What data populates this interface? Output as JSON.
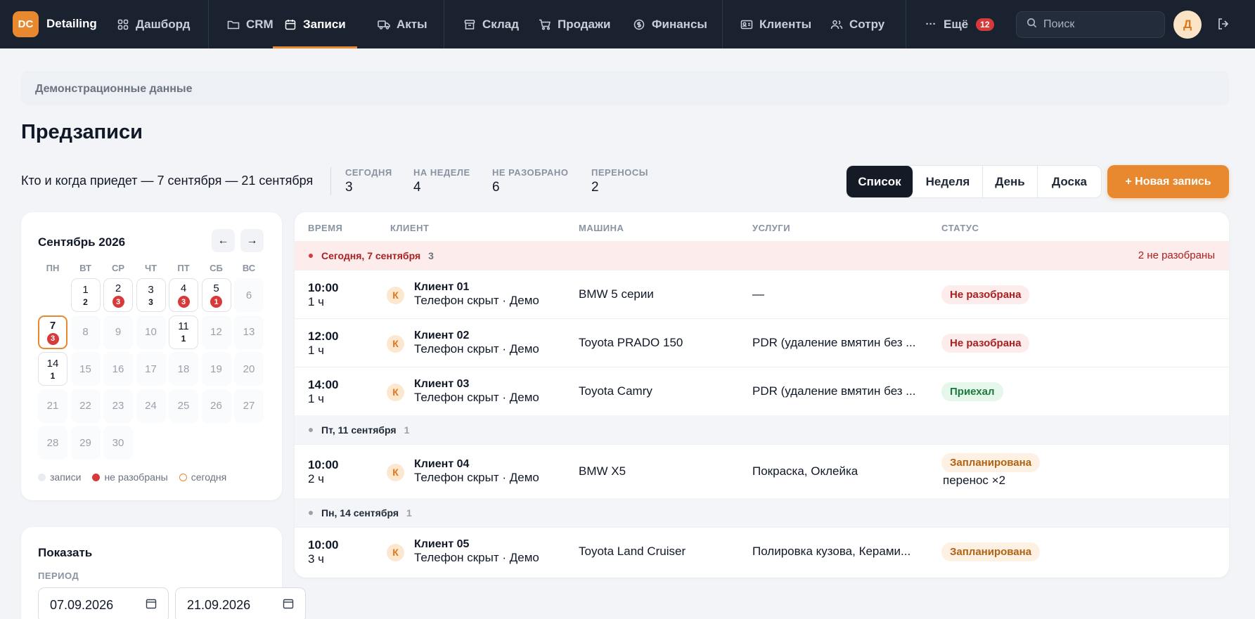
{
  "app": {
    "logo_text": "DC",
    "brand": "Detailing"
  },
  "nav": {
    "items": [
      {
        "label": "Дашборд",
        "icon": "dashboard-icon"
      },
      {
        "label": "CRM",
        "icon": "folder-icon"
      },
      {
        "label": "Записи",
        "icon": "calendar-icon",
        "active": true
      },
      {
        "label": "Акты",
        "icon": "truck-icon"
      },
      {
        "label": "Склад",
        "icon": "archive-icon"
      },
      {
        "label": "Продажи",
        "icon": "cart-icon"
      },
      {
        "label": "Финансы",
        "icon": "dollar-icon"
      },
      {
        "label": "Клиенты",
        "icon": "id-card-icon"
      },
      {
        "label": "Сотру",
        "icon": "users-icon"
      },
      {
        "label": "Ещё",
        "icon": "more-icon",
        "badge": "12"
      }
    ],
    "search_placeholder": "Поиск",
    "avatar": "Д"
  },
  "banner": "Демонстрационные данные",
  "page": {
    "title": "Предзаписи",
    "subtitle": "Кто и когда приедет — 7 сентября — 21 сентября",
    "stats": [
      {
        "label": "СЕГОДНЯ",
        "value": "3"
      },
      {
        "label": "НА НЕДЕЛЕ",
        "value": "4"
      },
      {
        "label": "НЕ РАЗОБРАНО",
        "value": "6"
      },
      {
        "label": "ПЕРЕНОСЫ",
        "value": "2"
      }
    ],
    "views": [
      "Список",
      "Неделя",
      "День",
      "Доска"
    ],
    "active_view": "Список",
    "new_button": "+ Новая запись"
  },
  "calendar": {
    "title": "Сентябрь 2026",
    "weekdays": [
      "ПН",
      "ВТ",
      "СР",
      "ЧТ",
      "ПТ",
      "СБ",
      "ВС"
    ],
    "days": [
      {
        "d": "1",
        "c": "2"
      },
      {
        "d": "2",
        "c": "3",
        "red": true
      },
      {
        "d": "3",
        "c": "3"
      },
      {
        "d": "4",
        "c": "3",
        "red": true
      },
      {
        "d": "5",
        "c": "1",
        "red": true
      },
      {
        "d": "6"
      },
      {
        "d": "7",
        "c": "3",
        "red": true,
        "today": true
      },
      {
        "d": "8"
      },
      {
        "d": "9"
      },
      {
        "d": "10"
      },
      {
        "d": "11",
        "c": "1"
      },
      {
        "d": "12"
      },
      {
        "d": "13"
      },
      {
        "d": "14",
        "c": "1"
      },
      {
        "d": "15"
      },
      {
        "d": "16"
      },
      {
        "d": "17"
      },
      {
        "d": "18"
      },
      {
        "d": "19"
      },
      {
        "d": "20"
      },
      {
        "d": "21"
      },
      {
        "d": "22"
      },
      {
        "d": "23"
      },
      {
        "d": "24"
      },
      {
        "d": "25"
      },
      {
        "d": "26"
      },
      {
        "d": "27"
      },
      {
        "d": "28"
      },
      {
        "d": "29"
      },
      {
        "d": "30"
      }
    ],
    "legend": [
      "записи",
      "не разобраны",
      "сегодня"
    ]
  },
  "show": {
    "title": "Показать",
    "period_label": "ПЕРИОД",
    "from": "07.09.2026",
    "to": "21.09.2026"
  },
  "table": {
    "headers": [
      "ВРЕМЯ",
      "КЛИЕНТ",
      "МАШИНА",
      "УСЛУГИ",
      "СТАТУС"
    ],
    "groups": [
      {
        "title": "Сегодня, 7 сентября",
        "count": "3",
        "note": "2 не разобраны",
        "today": true,
        "rows": [
          {
            "time": "10:00",
            "dur": "1 ч",
            "avatar": "К",
            "client": "Клиент 01",
            "sub": "Телефон скрыт · Демо",
            "car": "BMW 5 серии",
            "services": "—",
            "status": "Не разобрана",
            "status_type": "red"
          },
          {
            "time": "12:00",
            "dur": "1 ч",
            "avatar": "К",
            "client": "Клиент 02",
            "sub": "Телефон скрыт · Демо",
            "car": "Toyota PRADO 150",
            "services": "PDR (удаление вмятин без ...",
            "status": "Не разобрана",
            "status_type": "red"
          },
          {
            "time": "14:00",
            "dur": "1 ч",
            "avatar": "К",
            "client": "Клиент 03",
            "sub": "Телефон скрыт · Демо",
            "car": "Toyota Camry",
            "services": "PDR (удаление вмятин без ...",
            "status": "Приехал",
            "status_type": "green"
          }
        ]
      },
      {
        "title": "Пт, 11 сентября",
        "count": "1",
        "rows": [
          {
            "time": "10:00",
            "dur": "2 ч",
            "avatar": "К",
            "client": "Клиент 04",
            "sub": "Телефон скрыт · Демо",
            "car": "BMW X5",
            "services": "Покраска, Оклейка",
            "status": "Запланирована",
            "status_type": "orange",
            "extra": "перенос ×2"
          }
        ]
      },
      {
        "title": "Пн, 14 сентября",
        "count": "1",
        "rows": [
          {
            "time": "10:00",
            "dur": "3 ч",
            "avatar": "К",
            "client": "Клиент 05",
            "sub": "Телефон скрыт · Демо",
            "car": "Toyota Land Cruiser",
            "services": "Полировка кузова, Керами...",
            "status": "Запланирована",
            "status_type": "orange"
          }
        ]
      }
    ]
  },
  "colors": {
    "accent": "#e8892f",
    "nav_bg": "#1a2230",
    "danger": "#d63a3a"
  }
}
